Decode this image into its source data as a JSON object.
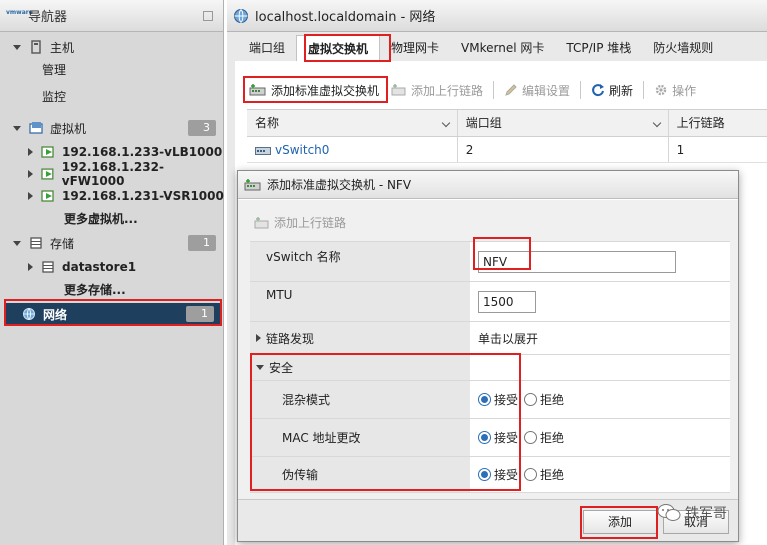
{
  "navigator": {
    "logo_text": "vmware",
    "title": "导航器",
    "items": [
      {
        "label": "主机"
      },
      {
        "label": "管理"
      },
      {
        "label": "监控"
      },
      {
        "label": "虚拟机",
        "badge": "3"
      },
      {
        "label": "192.168.1.233-vLB1000"
      },
      {
        "label": "192.168.1.232-vFW1000"
      },
      {
        "label": "192.168.1.231-VSR1000"
      },
      {
        "label": "更多虚拟机..."
      },
      {
        "label": "存储",
        "badge": "1"
      },
      {
        "label": "datastore1"
      },
      {
        "label": "更多存储..."
      },
      {
        "label": "网络",
        "badge": "1"
      }
    ]
  },
  "main": {
    "host_title": "localhost.localdomain - 网络",
    "tabs": [
      {
        "label": "端口组"
      },
      {
        "label": "虚拟交换机"
      },
      {
        "label": "物理网卡"
      },
      {
        "label": "VMkernel 网卡"
      },
      {
        "label": "TCP/IP 堆栈"
      },
      {
        "label": "防火墙规则"
      }
    ],
    "toolbar": {
      "add_switch": "添加标准虚拟交换机",
      "add_uplink": "添加上行链路",
      "edit_settings": "编辑设置",
      "refresh": "刷新",
      "actions": "操作"
    },
    "table": {
      "columns": [
        "名称",
        "端口组",
        "上行链路"
      ],
      "rows": [
        {
          "name": "vSwitch0",
          "portgroups": "2",
          "uplinks": "1"
        }
      ]
    }
  },
  "modal": {
    "title": "添加标准虚拟交换机 - NFV",
    "add_uplink": "添加上行链路",
    "fields": {
      "vswitch_name_label": "vSwitch 名称",
      "vswitch_name_value": "NFV",
      "mtu_label": "MTU",
      "mtu_value": "1500",
      "link_discovery_label": "链路发现",
      "link_discovery_value": "单击以展开",
      "security_label": "安全",
      "promiscuous_label": "混杂模式",
      "mac_change_label": "MAC 地址更改",
      "forged_label": "伪传输",
      "accept": "接受",
      "reject": "拒绝"
    },
    "security_values": {
      "promiscuous": "接受",
      "mac_change": "接受",
      "forged": "接受"
    },
    "buttons": {
      "add": "添加",
      "cancel": "取消"
    }
  },
  "watermark": {
    "text": "铁军哥"
  },
  "colors": {
    "highlight": "#e02020",
    "link": "#1f63b0",
    "radio": "#2c6fb7"
  }
}
